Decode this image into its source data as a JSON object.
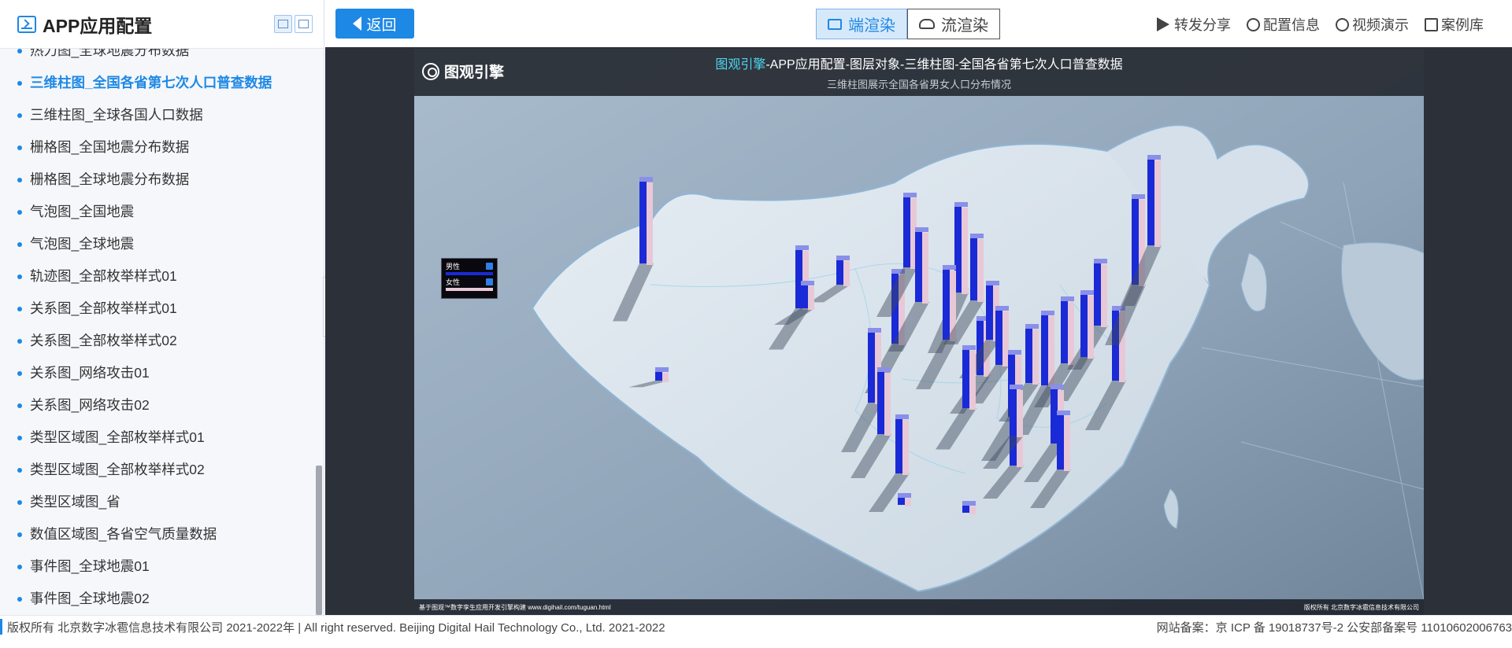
{
  "sidebar": {
    "title": "APP应用配置",
    "items": [
      {
        "label": "热力图_全球地震分布数据",
        "active": false
      },
      {
        "label": "三维柱图_全国各省第七次人口普查数据",
        "active": true
      },
      {
        "label": "三维柱图_全球各国人口数据",
        "active": false
      },
      {
        "label": "栅格图_全国地震分布数据",
        "active": false
      },
      {
        "label": "栅格图_全球地震分布数据",
        "active": false
      },
      {
        "label": "气泡图_全国地震",
        "active": false
      },
      {
        "label": "气泡图_全球地震",
        "active": false
      },
      {
        "label": "轨迹图_全部枚举样式01",
        "active": false
      },
      {
        "label": "关系图_全部枚举样式01",
        "active": false
      },
      {
        "label": "关系图_全部枚举样式02",
        "active": false
      },
      {
        "label": "关系图_网络攻击01",
        "active": false
      },
      {
        "label": "关系图_网络攻击02",
        "active": false
      },
      {
        "label": "类型区域图_全部枚举样式01",
        "active": false
      },
      {
        "label": "类型区域图_全部枚举样式02",
        "active": false
      },
      {
        "label": "类型区域图_省",
        "active": false
      },
      {
        "label": "数值区域图_各省空气质量数据",
        "active": false
      },
      {
        "label": "事件图_全球地震01",
        "active": false
      },
      {
        "label": "事件图_全球地震02",
        "active": false
      }
    ]
  },
  "topbar": {
    "back_label": "返回",
    "render_end": "端渲染",
    "render_stream": "流渲染",
    "links": [
      "转发分享",
      "配置信息",
      "视频演示",
      "案例库"
    ]
  },
  "map": {
    "logo": "图观引擎",
    "title_brand": "图观引擎",
    "title_rest": "-APP应用配置-图层对象-三维柱图-全国各省第七次人口普查数据",
    "subtitle": "三维柱图展示全国各省男女人口分布情况",
    "legend": {
      "male": "男性",
      "female": "女性",
      "male_color": "#1a2ad6",
      "female_color": "#e8c8d6"
    },
    "foot_left": "基于图观™数字孪生应用开发引擎构建 www.digihail.com/tuguan.html",
    "foot_right": "版权所有 北京数字冰雹信息技术有限公司"
  },
  "footer": {
    "left": "版权所有 北京数字冰雹信息技术有限公司 2021-2022年 | All right reserved. Beijing Digital Hail Technology Co., Ltd. 2021-2022",
    "right": "网站备案：京 ICP 备 19018737号-2 公安部备案号 11010602006763"
  },
  "colors": {
    "accent": "#1e88e5",
    "male_bar": "#1a2ad6",
    "female_bar": "#e8c8d6"
  }
}
